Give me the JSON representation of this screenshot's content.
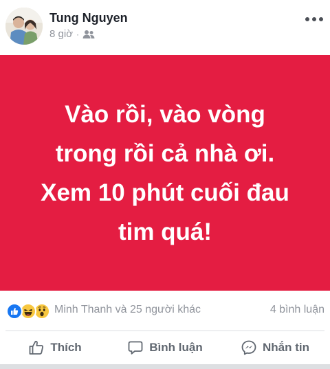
{
  "post": {
    "author": "Tung Nguyen",
    "time": "8 giờ",
    "separator": "·",
    "audience_icon": "friends-icon",
    "more_icon": "more-dots-icon",
    "background_color": "#e41d42",
    "text": "Vào rồi, vào vòng\ntrong rồi cả nhà ơi.\nXem 10 phút cuối đau\ntim quá!"
  },
  "reactions": {
    "icons": [
      "like-reaction-icon",
      "haha-reaction-icon",
      "wow-reaction-icon"
    ],
    "names": "Minh Thanh và 25 người khác",
    "comments": "4 bình luận"
  },
  "actions": {
    "like_label": "Thích",
    "comment_label": "Bình luận",
    "message_label": "Nhắn tin"
  },
  "colors": {
    "accent": "#1877f2",
    "muted_text": "#90949c",
    "action_text": "#606770"
  }
}
